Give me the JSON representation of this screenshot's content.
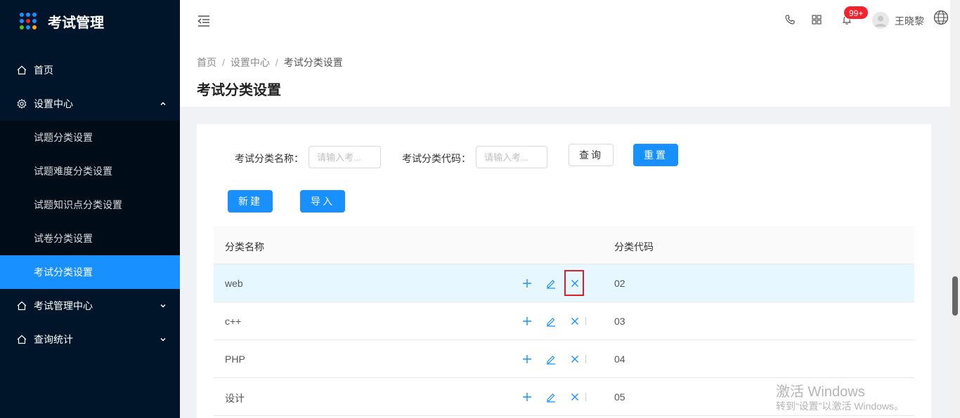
{
  "app": {
    "title": "考试管理"
  },
  "sidebar": {
    "items": [
      {
        "label": "首页",
        "icon": "home-icon"
      },
      {
        "label": "设置中心",
        "icon": "gear-icon",
        "expanded": true
      },
      {
        "label": "考试管理中心",
        "icon": "home-icon"
      },
      {
        "label": "查询统计",
        "icon": "home-icon"
      }
    ],
    "sub_items": [
      {
        "label": "试题分类设置"
      },
      {
        "label": "试题难度分类设置"
      },
      {
        "label": "试题知识点分类设置"
      },
      {
        "label": "试卷分类设置"
      },
      {
        "label": "考试分类设置",
        "active": true
      }
    ]
  },
  "header": {
    "notification_count": "99+",
    "username": "王晓黎"
  },
  "breadcrumb": [
    "首页",
    "设置中心",
    "考试分类设置"
  ],
  "page_title": "考试分类设置",
  "filters": {
    "name_label": "考试分类名称：",
    "name_placeholder": "请输入考...",
    "code_label": "考试分类代码：",
    "code_placeholder": "请输入考...",
    "query_button": "查询",
    "reset_button": "重置"
  },
  "actions": {
    "new_button": "新建",
    "import_button": "导入"
  },
  "table": {
    "columns": [
      "分类名称",
      "分类代码"
    ],
    "rows": [
      {
        "name": "web",
        "code": "02"
      },
      {
        "name": "c++",
        "code": "03"
      },
      {
        "name": "PHP",
        "code": "04"
      },
      {
        "name": "设计",
        "code": "05"
      }
    ]
  },
  "watermark": {
    "line1": "激活 Windows",
    "line2": "转到“设置”以激活 Windows。"
  },
  "colors": {
    "sidebar_bg": "#001529",
    "primary": "#1890ff",
    "badge": "#f5222d",
    "highlight": "#e02020"
  }
}
